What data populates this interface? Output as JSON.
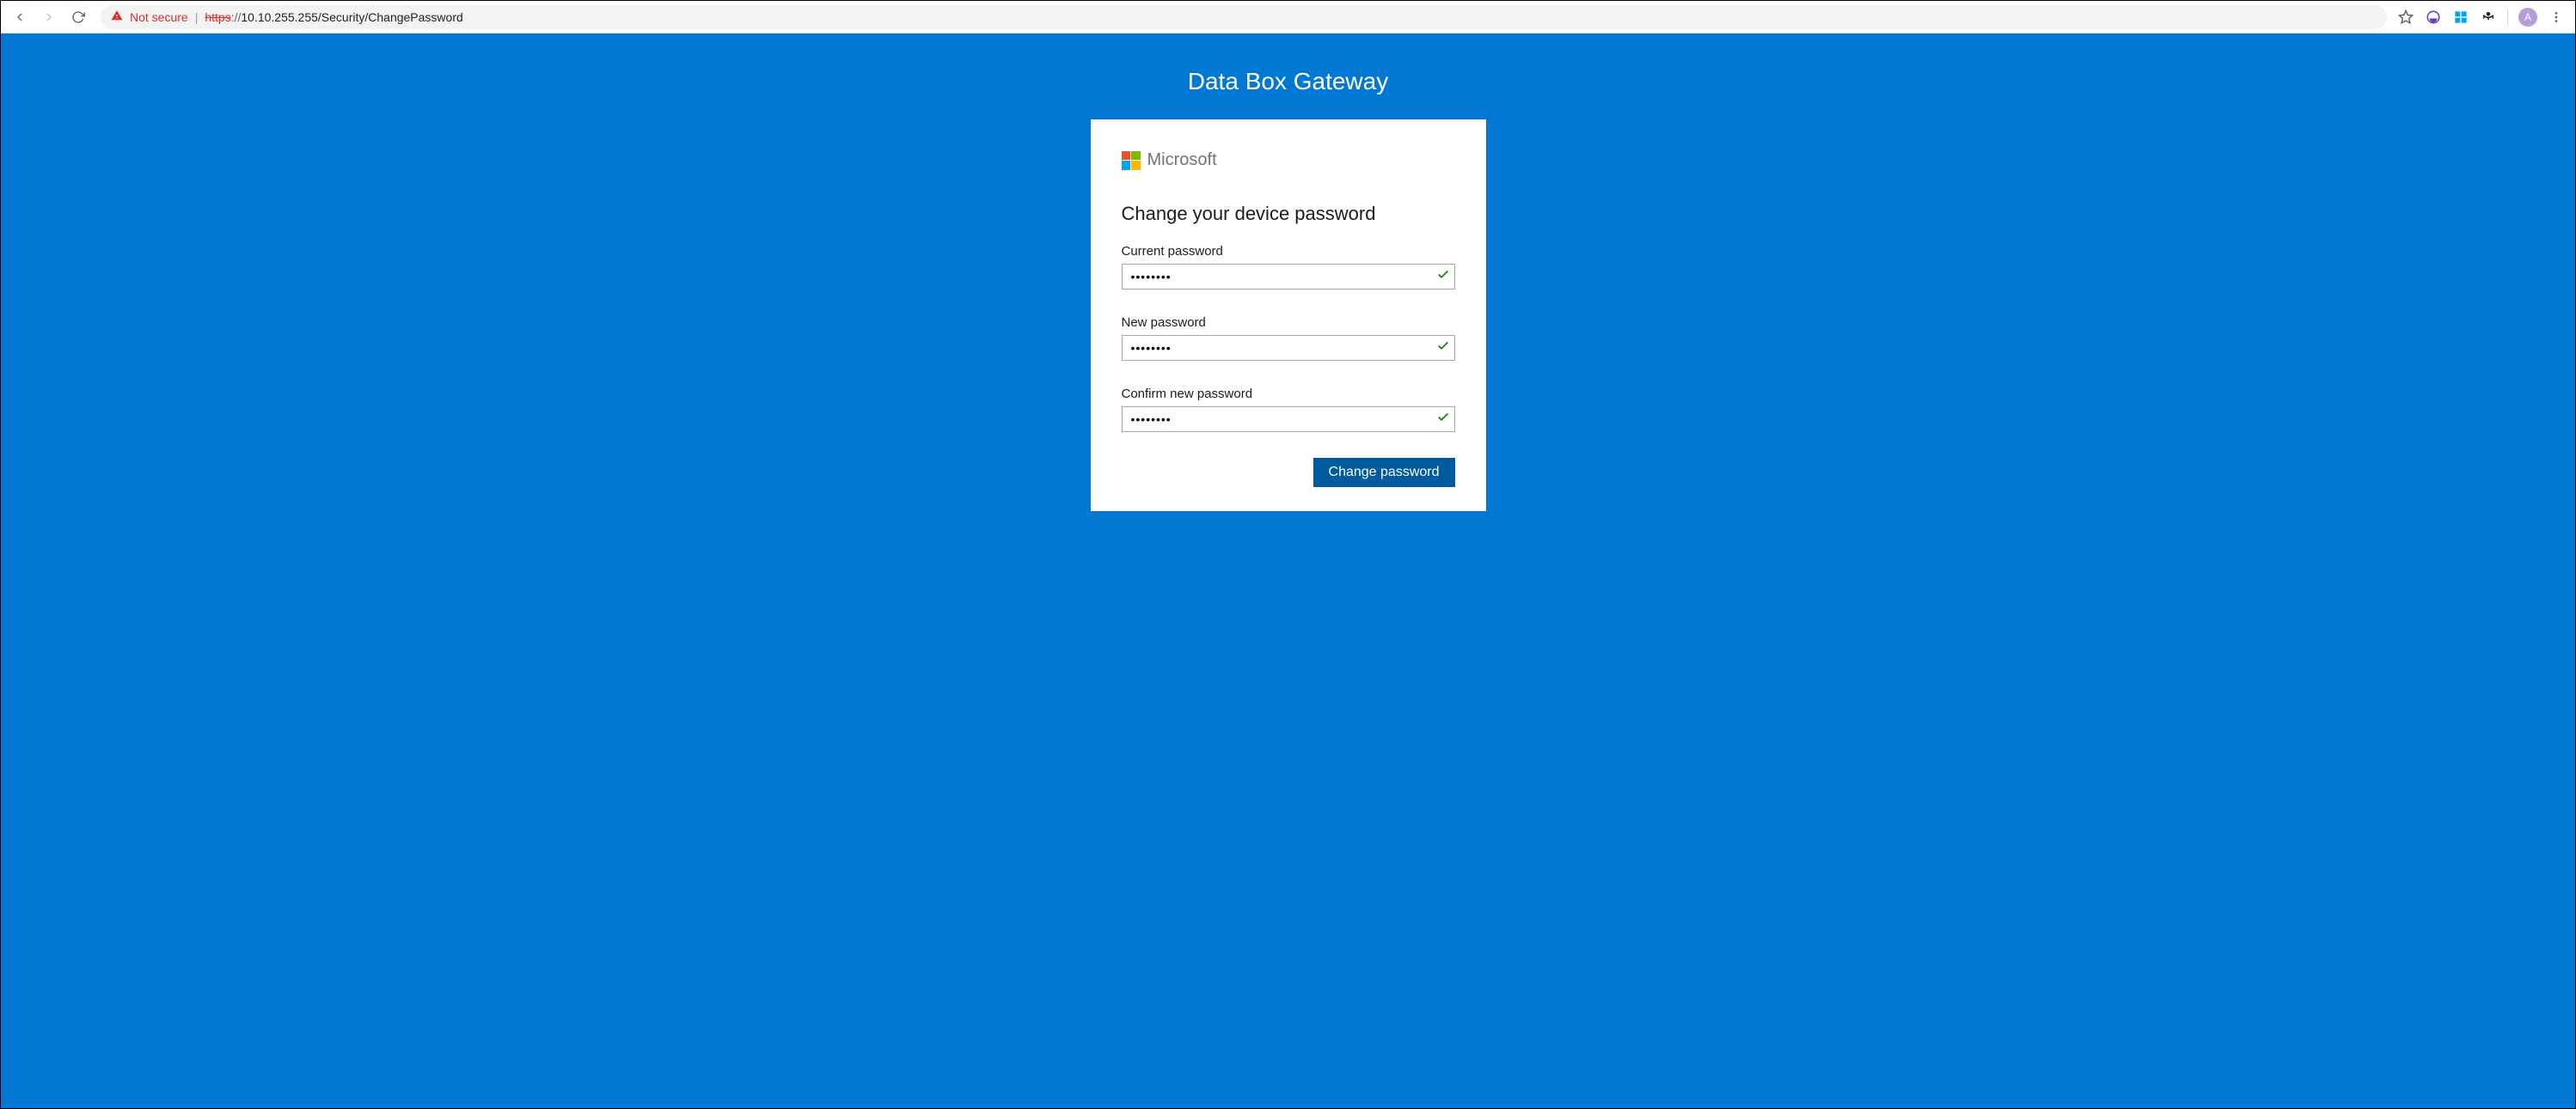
{
  "browser": {
    "not_secure_label": "Not secure",
    "url_scheme_striked": "https",
    "url_scheme_rest": "://",
    "url_main": "10.10.255.255/Security/ChangePassword",
    "avatar_initial": "A"
  },
  "page": {
    "title": "Data Box Gateway",
    "brand": "Microsoft",
    "form_heading": "Change your device password",
    "labels": {
      "current": "Current password",
      "new": "New password",
      "confirm": "Confirm new password"
    },
    "values": {
      "current": "••••••••",
      "new": "••••••••",
      "confirm": "••••••••"
    },
    "button": "Change password"
  },
  "colors": {
    "page_bg": "#0078d4",
    "button_bg": "#005a9e",
    "valid_check": "#107c10"
  }
}
